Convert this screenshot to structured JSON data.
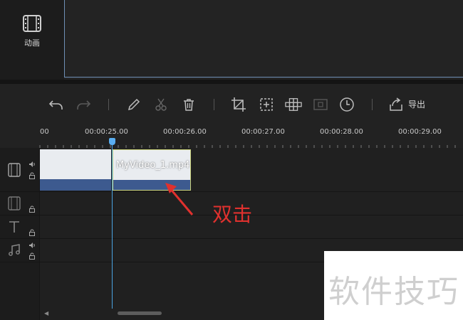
{
  "sidebar": {
    "animation_label": "动画"
  },
  "toolbar": {
    "export_label": "导出"
  },
  "ruler": {
    "ticks": [
      {
        "label": "00"
      },
      {
        "label": "00:00:25.00"
      },
      {
        "label": "00:00:26.00"
      },
      {
        "label": "00:00:27.00"
      },
      {
        "label": "00:00:28.00"
      },
      {
        "label": "00:00:29.00"
      }
    ]
  },
  "timeline": {
    "clip_name": "MyVideo_1.mp4"
  },
  "annotation": {
    "text": "双击"
  },
  "watermark": {
    "text": "软件技巧"
  },
  "colors": {
    "accent": "#4aa3e0",
    "annotation": "#e0312e",
    "clip_wave": "#3d5a8f",
    "clip_selected_border": "#c9d17a"
  },
  "icons": [
    "film-icon",
    "undo-icon",
    "redo-icon",
    "pencil-icon",
    "scissors-icon",
    "trash-icon",
    "crop-icon",
    "add-frame-icon",
    "mosaic-icon",
    "record-icon",
    "clock-icon",
    "export-icon",
    "speaker-icon",
    "lock-icon",
    "text-icon",
    "music-icon"
  ]
}
